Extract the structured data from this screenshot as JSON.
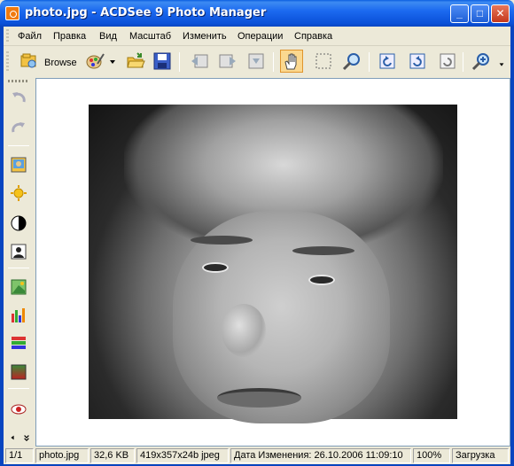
{
  "window": {
    "title": "photo.jpg - ACDSee 9 Photo Manager",
    "minimize": "_",
    "maximize": "□",
    "close": "✕"
  },
  "menu": [
    "Файл",
    "Правка",
    "Вид",
    "Масштаб",
    "Изменить",
    "Операции",
    "Справка"
  ],
  "toolbar": {
    "browse_label": "Browse",
    "icons": [
      "browse-icon",
      "edit-icon",
      "open-folder-icon",
      "save-icon",
      "previous-icon",
      "next-icon",
      "fit-icon",
      "hand-icon",
      "select-icon",
      "zoom-icon",
      "rotate-left-icon",
      "rotate-right-icon",
      "flip-icon",
      "zoom-in-icon"
    ]
  },
  "sidebar": {
    "icons": [
      "undo-icon",
      "redo-icon",
      "photo-repair-icon",
      "exposure-icon",
      "contrast-icon",
      "shadows-icon",
      "color-icon",
      "levels-icon",
      "curves-icon",
      "gradient-icon",
      "red-eye-icon"
    ]
  },
  "statusbar": {
    "index": "1/1",
    "filename": "photo.jpg",
    "filesize": "32,6 KB",
    "dimensions": "419x357x24b jpeg",
    "modified": "Дата Изменения: 26.10.2006 11:09:10",
    "zoom": "100%",
    "status": "Загрузка"
  },
  "colors": {
    "titlebar": "#0a50d8",
    "active_tool": "#fbd88f",
    "chrome": "#ece9d8"
  }
}
